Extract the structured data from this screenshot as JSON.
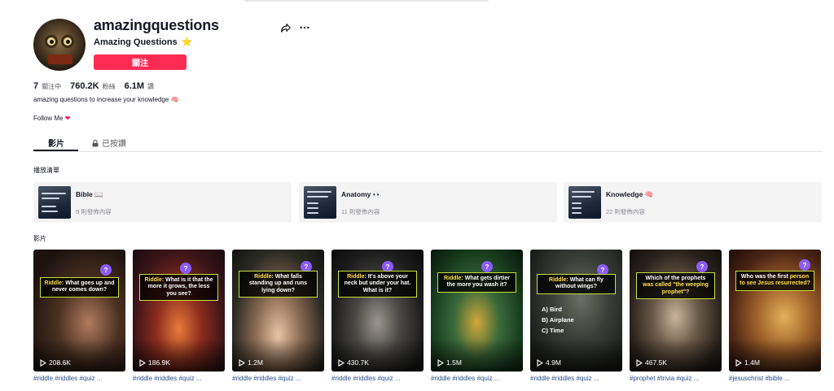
{
  "profile": {
    "username": "amazingquestions",
    "nickname": "Amazing Questions",
    "nickname_badge": "⭐",
    "follow_label": "關注",
    "stats": [
      {
        "value": "7",
        "label": "關注中"
      },
      {
        "value": "760.2K",
        "label": "粉絲"
      },
      {
        "value": "6.1M",
        "label": "讚"
      }
    ],
    "bio": "amazing questions to increase your knowledge",
    "bio_emoji": "🧠",
    "bio2": "Follow Me",
    "bio2_emoji": "❤"
  },
  "tabs": {
    "videos": "影片",
    "liked": "已按讚"
  },
  "sections": {
    "playlists": "播放清單",
    "videos": "影片"
  },
  "playlists": [
    {
      "name": "Bible",
      "emoji": "📖",
      "count": "9 則發佈內容"
    },
    {
      "name": "Anatomy",
      "emoji": "👀",
      "count": "11 則發佈內容"
    },
    {
      "name": "Knowledge",
      "emoji": "🧠",
      "count": "22 則發佈內容"
    }
  ],
  "videos": [
    {
      "caption_a": "Riddle:",
      "caption_b": " What goes up and never comes down?",
      "views": "208.6K",
      "tags": "#riddle #riddles #quiz ..."
    },
    {
      "caption_a": "Riddle:",
      "caption_b": " What is it that the more it grows, the less you see?",
      "views": "186.9K",
      "tags": "#riddle #riddles #quiz ..."
    },
    {
      "caption_a": "Riddle:",
      "caption_b": " What falls standing up and runs lying down?",
      "views": "1.2M",
      "tags": "#riddle #riddles #quiz ..."
    },
    {
      "caption_a": "Riddle:",
      "caption_b": " It's above your neck but under your hat. What is it?",
      "views": "430.7K",
      "tags": "#riddle #riddles #quiz ..."
    },
    {
      "caption_a": "Riddle:",
      "caption_b": " What gets dirtier the more you wash it?",
      "views": "1.5M",
      "tags": "#riddle #riddles #quiz ..."
    },
    {
      "caption_a": "Riddle:",
      "caption_b": " What can fly without wings?",
      "views": "4.9M",
      "tags": "#riddle #riddles #quiz ...",
      "options": [
        "A)  Bird",
        "B)  Airplane",
        "C)  Time"
      ]
    },
    {
      "caption_a": "Which of the prophets",
      "caption_b": " was called \"the weeping prophet\"?",
      "views": "467.5K",
      "tags": "#prophet #trivia #quiz ..."
    },
    {
      "caption_a": "Who was the first",
      "caption_b": " person to see Jesus resurrected?",
      "views": "1.4M",
      "tags": "#jesuschrist #bible ..."
    }
  ],
  "colors": {
    "accent": "#fe2c55",
    "tag_link": "#2b4b8c"
  }
}
